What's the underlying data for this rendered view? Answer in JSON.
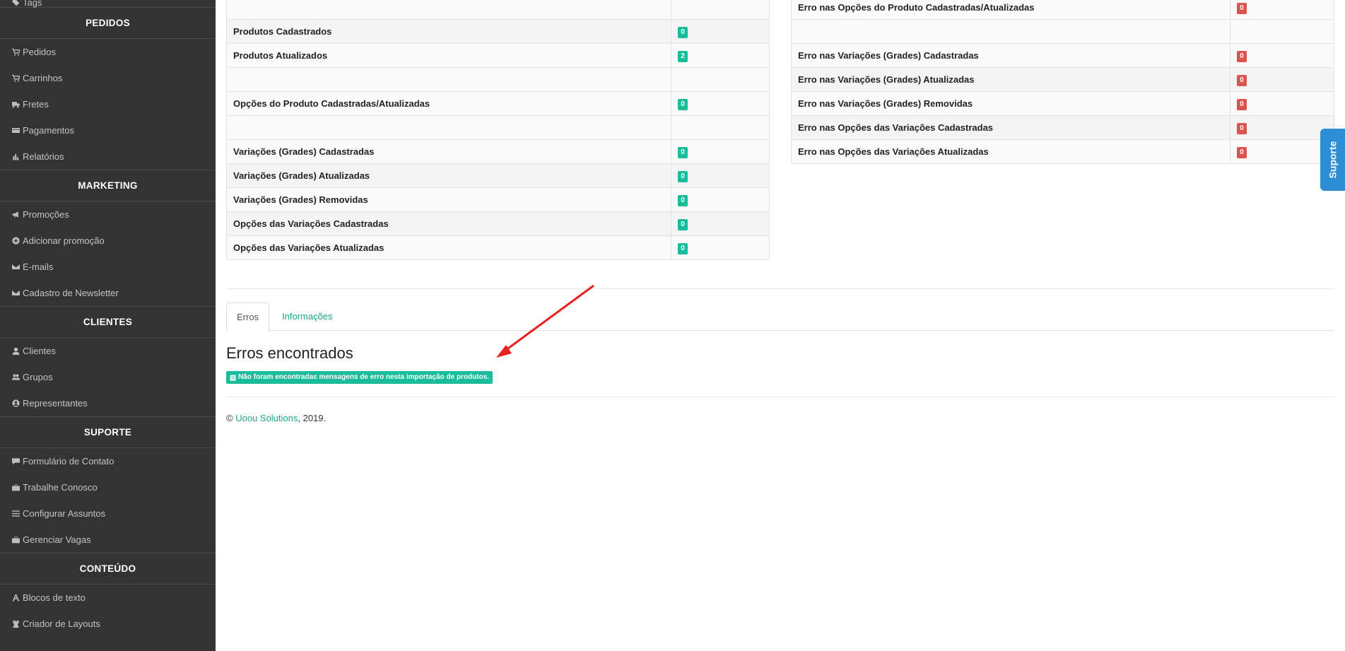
{
  "sidebar": {
    "partial_item": {
      "label": "Tags",
      "icon": "tag-icon"
    },
    "sections": [
      {
        "title": "PEDIDOS",
        "items": [
          {
            "label": "Pedidos",
            "icon": "cart-icon"
          },
          {
            "label": "Carrinhos",
            "icon": "cart-icon"
          },
          {
            "label": "Fretes",
            "icon": "truck-icon"
          },
          {
            "label": "Pagamentos",
            "icon": "credit-card-icon"
          },
          {
            "label": "Relatórios",
            "icon": "bar-chart-icon"
          }
        ]
      },
      {
        "title": "MARKETING",
        "items": [
          {
            "label": "Promoções",
            "icon": "bullhorn-icon"
          },
          {
            "label": "Adicionar promoção",
            "icon": "plus-circle-icon"
          },
          {
            "label": "E-mails",
            "icon": "envelope-icon"
          },
          {
            "label": "Cadastro de Newsletter",
            "icon": "envelope-icon"
          }
        ]
      },
      {
        "title": "CLIENTES",
        "items": [
          {
            "label": "Clientes",
            "icon": "user-icon"
          },
          {
            "label": "Grupos",
            "icon": "users-icon"
          },
          {
            "label": "Representantes",
            "icon": "user-circle-icon"
          }
        ]
      },
      {
        "title": "SUPORTE",
        "items": [
          {
            "label": "Formulário de Contato",
            "icon": "comment-icon"
          },
          {
            "label": "Trabalhe Conosco",
            "icon": "briefcase-icon"
          },
          {
            "label": "Configurar Assuntos",
            "icon": "list-icon"
          },
          {
            "label": "Gerenciar Vagas",
            "icon": "briefcase-icon"
          }
        ]
      },
      {
        "title": "CONTEÚDO",
        "items": [
          {
            "label": "Blocos de texto",
            "icon": "font-icon"
          },
          {
            "label": "Criador de Layouts",
            "icon": "chess-rook-icon"
          }
        ]
      }
    ]
  },
  "left_table": [
    {
      "label": "",
      "value": ""
    },
    {
      "label": "Produtos Cadastrados",
      "value": "0"
    },
    {
      "label": "Produtos Atualizados",
      "value": "2"
    },
    {
      "label": "",
      "value": ""
    },
    {
      "label": "Opções do Produto Cadastradas/Atualizadas",
      "value": "0"
    },
    {
      "label": "",
      "value": ""
    },
    {
      "label": "Variações (Grades) Cadastradas",
      "value": "0"
    },
    {
      "label": "Variações (Grades) Atualizadas",
      "value": "0"
    },
    {
      "label": "Variações (Grades) Removidas",
      "value": "0"
    },
    {
      "label": "Opções das Variações Cadastradas",
      "value": "0"
    },
    {
      "label": "Opções das Variações Atualizadas",
      "value": "0"
    }
  ],
  "right_table": [
    {
      "label": "Erro nas Opções do Produto Cadastradas/Atualizadas",
      "value": "0"
    },
    {
      "label": "",
      "value": ""
    },
    {
      "label": "Erro nas Variações (Grades) Cadastradas",
      "value": "0"
    },
    {
      "label": "Erro nas Variações (Grades) Atualizadas",
      "value": "0"
    },
    {
      "label": "Erro nas Variações (Grades) Removidas",
      "value": "0"
    },
    {
      "label": "Erro nas Opções das Variações Cadastradas",
      "value": "0"
    },
    {
      "label": "Erro nas Opções das Variações Atualizadas",
      "value": "0"
    }
  ],
  "tabs": [
    {
      "label": "Erros",
      "active": true
    },
    {
      "label": "Informações",
      "active": false
    }
  ],
  "errors_section": {
    "heading": "Erros encontrados",
    "notice": "Não foram encontradas mensagens de erro nesta importação de produtos."
  },
  "footer": {
    "prefix": "© ",
    "link": "Uoou Solutions",
    "suffix": ", 2019."
  },
  "support_tab": {
    "label": "Suporte"
  },
  "colors": {
    "sidebar_bg": "#333333",
    "accent": "#1abc9c",
    "link": "#1aa88b",
    "error": "#d9534f",
    "support": "#2c8fd6",
    "annotation_arrow": "#e8231f"
  }
}
